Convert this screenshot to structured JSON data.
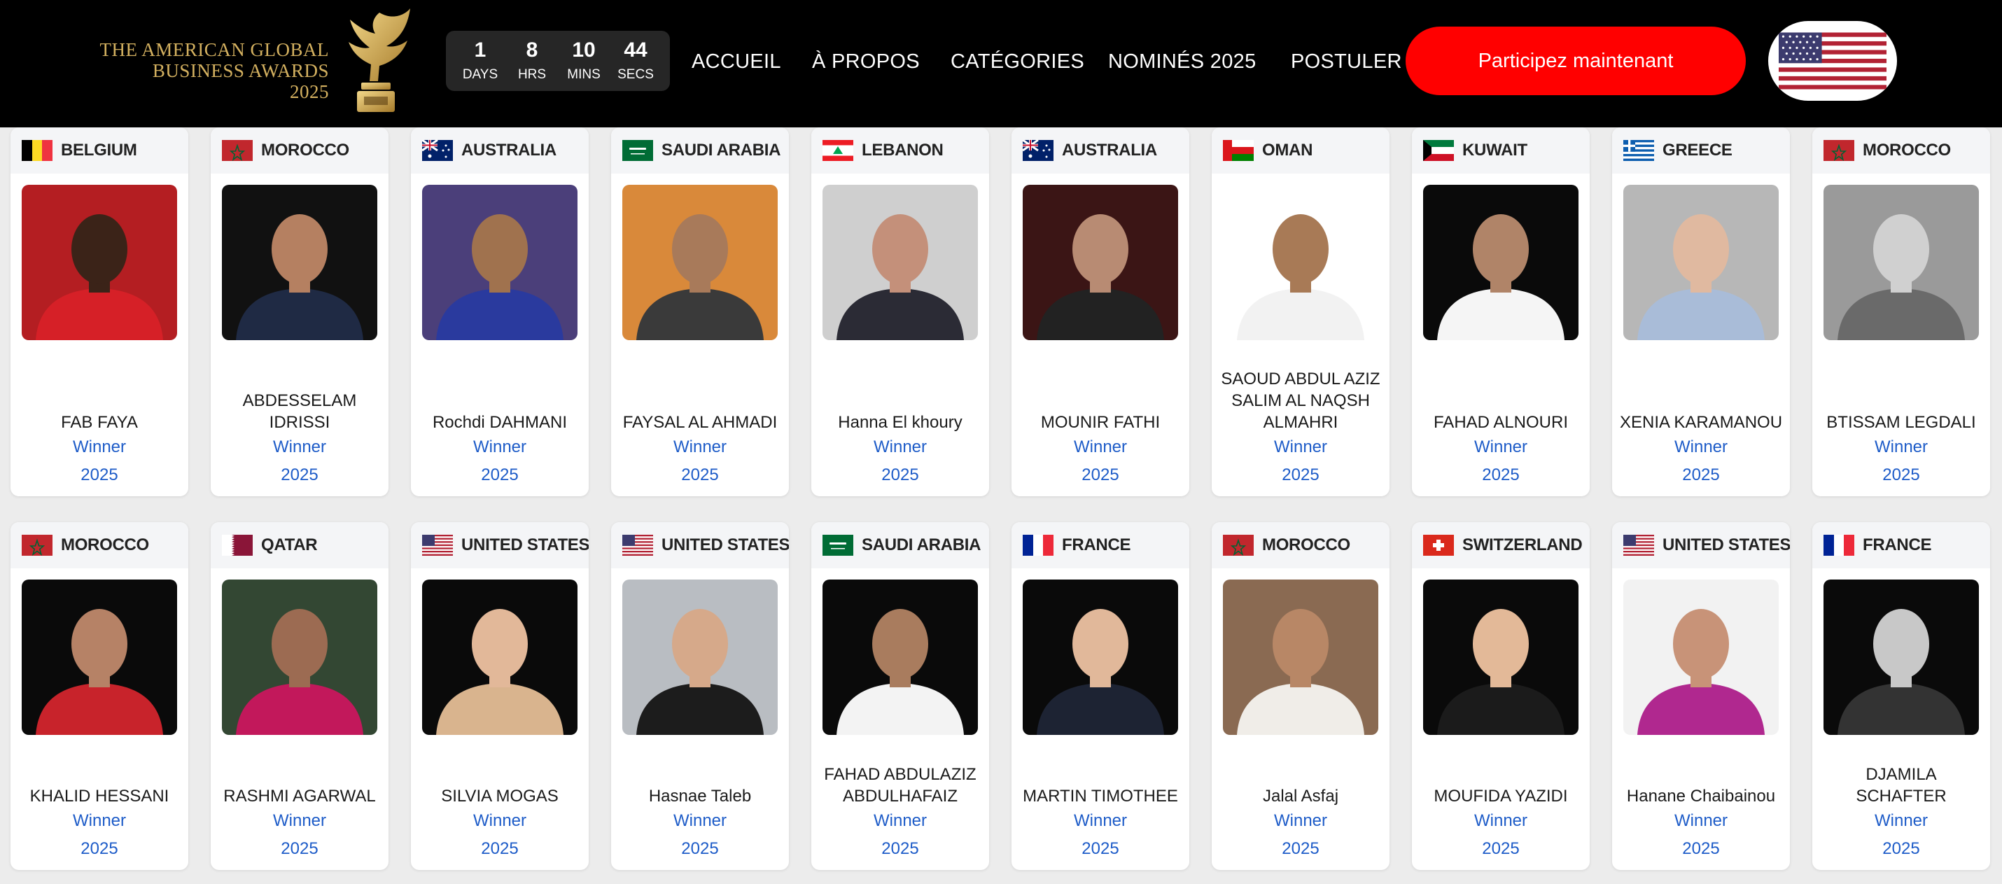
{
  "header": {
    "logo_lines": [
      "THE AMERICAN GLOBAL",
      "BUSINESS AWARDS",
      "2025"
    ],
    "countdown": [
      {
        "value": "1",
        "label": "DAYS"
      },
      {
        "value": "8",
        "label": "HRS"
      },
      {
        "value": "10",
        "label": "MINS"
      },
      {
        "value": "44",
        "label": "SECS"
      }
    ],
    "nav": [
      "ACCUEIL",
      "À PROPOS",
      "CATÉGORIES",
      "NOMINÉS 2025",
      "POSTULER"
    ],
    "cta_label": "Participez maintenant",
    "language_flag": "us-flag-icon"
  },
  "colors": {
    "header_bg": "#000000",
    "logo_gold": "#d4b160",
    "cta_red": "#ff0000",
    "link_blue": "#1e5cc8",
    "card_head_bg": "#f4f5f7"
  },
  "cards": [
    {
      "country": "BELGIUM",
      "flag": "be",
      "name": "FAB FAYA",
      "status": "Winner",
      "year": "2025",
      "bg": "#b41e22",
      "skin": "#3b2318",
      "cloth": "#d62027",
      "gray": false
    },
    {
      "country": "MOROCCO",
      "flag": "ma",
      "name": "ABDESSELAM IDRISSI",
      "status": "Winner",
      "year": "2025",
      "bg": "#111111",
      "skin": "#b58061",
      "cloth": "#1f2a44",
      "gray": false
    },
    {
      "country": "AUSTRALIA",
      "flag": "au",
      "name": "Rochdi DAHMANI",
      "status": "Winner",
      "year": "2025",
      "bg": "#4b3f7a",
      "skin": "#a0724e",
      "cloth": "#2a3a9e",
      "gray": false
    },
    {
      "country": "SAUDI ARABIA",
      "flag": "sa",
      "name": "FAYSAL AL AHMADI",
      "status": "Winner",
      "year": "2025",
      "bg": "#d9893a",
      "skin": "#a87a5a",
      "cloth": "#3a3a3a",
      "gray": false
    },
    {
      "country": "LEBANON",
      "flag": "lb",
      "name": "Hanna El khoury",
      "status": "Winner",
      "year": "2025",
      "bg": "#cfcfcf",
      "skin": "#c4907a",
      "cloth": "#2b2b35",
      "gray": false
    },
    {
      "country": "AUSTRALIA",
      "flag": "au",
      "name": "MOUNIR FATHI",
      "status": "Winner",
      "year": "2025",
      "bg": "#3b1515",
      "skin": "#b88b73",
      "cloth": "#222222",
      "gray": false
    },
    {
      "country": "OMAN",
      "flag": "om",
      "name": "SAOUD ABDUL AZIZ SALIM AL NAQSH ALMAHRI",
      "status": "Winner",
      "year": "2025",
      "bg": "#ffffff",
      "skin": "#a87a56",
      "cloth": "#f2f2f2",
      "gray": false
    },
    {
      "country": "KUWAIT",
      "flag": "kw",
      "name": "FAHAD ALNOURI",
      "status": "Winner",
      "year": "2025",
      "bg": "#0a0a0a",
      "skin": "#b08468",
      "cloth": "#f5f5f5",
      "gray": false
    },
    {
      "country": "GREECE",
      "flag": "gr",
      "name": "XENIA KARAMANOU",
      "status": "Winner",
      "year": "2025",
      "bg": "#b7b7b7",
      "skin": "#e0b9a0",
      "cloth": "#a9bcd8",
      "gray": false
    },
    {
      "country": "MOROCCO",
      "flag": "ma",
      "name": "BTISSAM LEGDALI",
      "status": "Winner",
      "year": "2025",
      "bg": "#9a9a9a",
      "skin": "#d0d0d0",
      "cloth": "#6a6a6a",
      "gray": true
    },
    {
      "country": "MOROCCO",
      "flag": "ma",
      "name": "KHALID HESSANI",
      "status": "Winner",
      "year": "2025",
      "bg": "#0a0a0a",
      "skin": "#b68266",
      "cloth": "#c8232b",
      "gray": false
    },
    {
      "country": "QATAR",
      "flag": "qa",
      "name": "RASHMI AGARWAL",
      "status": "Winner",
      "year": "2025",
      "bg": "#334733",
      "skin": "#9c6b52",
      "cloth": "#c2185b",
      "gray": false
    },
    {
      "country": "UNITED STATES",
      "flag": "us",
      "name": "SILVIA MOGAS",
      "status": "Winner",
      "year": "2025",
      "bg": "#0a0a0a",
      "skin": "#e2b899",
      "cloth": "#d9b48e",
      "gray": false
    },
    {
      "country": "UNITED STATES",
      "flag": "us",
      "name": "Hasnae Taleb",
      "status": "Winner",
      "year": "2025",
      "bg": "#b9bdc2",
      "skin": "#d6a98a",
      "cloth": "#1c1c1c",
      "gray": false
    },
    {
      "country": "SAUDI ARABIA",
      "flag": "sa",
      "name": "FAHAD ABDULAZIZ ABDULHAFAIZ",
      "status": "Winner",
      "year": "2025",
      "bg": "#0a0a0a",
      "skin": "#a97c5e",
      "cloth": "#f3f3f3",
      "gray": false
    },
    {
      "country": "FRANCE",
      "flag": "fr",
      "name": "MARTIN TIMOTHEE",
      "status": "Winner",
      "year": "2025",
      "bg": "#0a0a0a",
      "skin": "#e1b89a",
      "cloth": "#1d2333",
      "gray": false
    },
    {
      "country": "MOROCCO",
      "flag": "ma",
      "name": "Jalal Asfaj",
      "status": "Winner",
      "year": "2025",
      "bg": "#8a6a52",
      "skin": "#b88766",
      "cloth": "#f0ede8",
      "gray": false
    },
    {
      "country": "SWITZERLAND",
      "flag": "ch",
      "name": "MOUFIDA YAZIDI",
      "status": "Winner",
      "year": "2025",
      "bg": "#0a0a0a",
      "skin": "#e3b998",
      "cloth": "#1b1b1b",
      "gray": false
    },
    {
      "country": "UNITED STATES",
      "flag": "us",
      "name": "Hanane Chaibainou",
      "status": "Winner",
      "year": "2025",
      "bg": "#f2f2f2",
      "skin": "#c89378",
      "cloth": "#b0288f",
      "gray": false
    },
    {
      "country": "FRANCE",
      "flag": "fr",
      "name": "DJAMILA SCHAFTER",
      "status": "Winner",
      "year": "2025",
      "bg": "#0a0a0a",
      "skin": "#c8c8c8",
      "cloth": "#333333",
      "gray": true
    }
  ]
}
